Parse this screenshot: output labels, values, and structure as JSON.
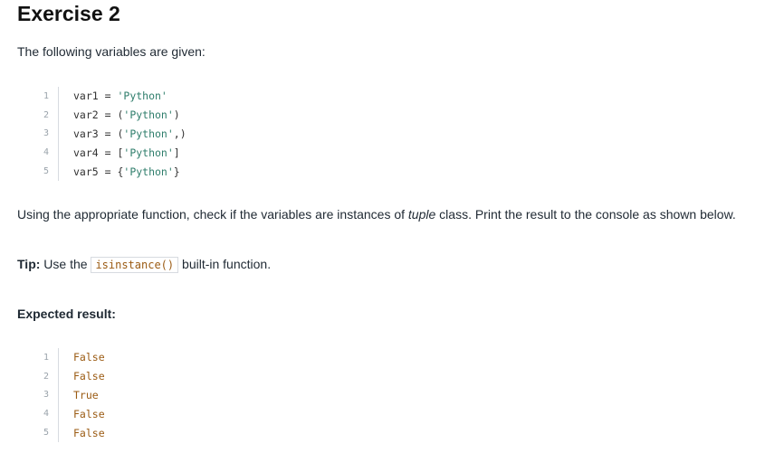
{
  "title": "Exercise 2",
  "intro": "The following variables are given:",
  "code_lines": [
    {
      "num": "1",
      "pre": "var1 = ",
      "str": "'Python'",
      "post": ""
    },
    {
      "num": "2",
      "pre": "var2 = (",
      "str": "'Python'",
      "post": ")"
    },
    {
      "num": "3",
      "pre": "var3 = (",
      "str": "'Python'",
      "post": ",)"
    },
    {
      "num": "4",
      "pre": "var4 = [",
      "str": "'Python'",
      "post": "]"
    },
    {
      "num": "5",
      "pre": "var5 = {",
      "str": "'Python'",
      "post": "}"
    }
  ],
  "instruction": {
    "before": "Using the appropriate function, check if the variables are instances of ",
    "emph": "tuple",
    "after": " class. Print the result to the console as shown below."
  },
  "tip": {
    "label": "Tip:",
    "before": " Use the ",
    "code": "isinstance()",
    "after": " built-in function."
  },
  "expected_heading": "Expected result:",
  "output_lines": [
    {
      "num": "1",
      "text": "False"
    },
    {
      "num": "2",
      "text": "False"
    },
    {
      "num": "3",
      "text": "True"
    },
    {
      "num": "4",
      "text": "False"
    },
    {
      "num": "5",
      "text": "False"
    }
  ]
}
